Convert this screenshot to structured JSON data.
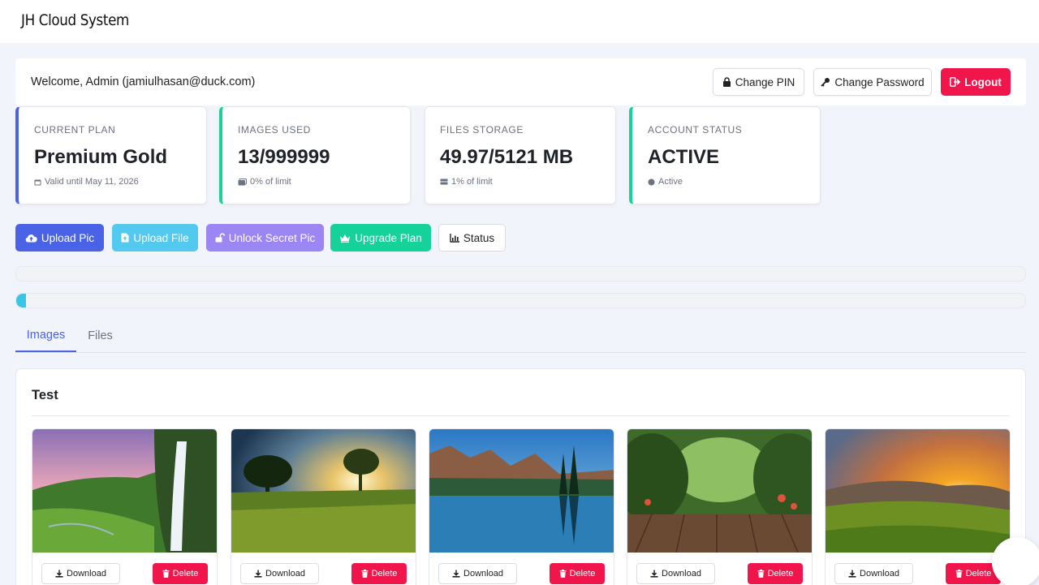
{
  "app": {
    "title": "JH Cloud System"
  },
  "header": {
    "welcome": "Welcome, Admin (jamiulhasan@duck.com)",
    "change_pin": "Change PIN",
    "change_password": "Change Password",
    "logout": "Logout"
  },
  "stats": [
    {
      "label": "CURRENT PLAN",
      "value": "Premium Gold",
      "sub": "Valid until May 11, 2026",
      "icon": "calendar-icon"
    },
    {
      "label": "IMAGES USED",
      "value": "13/999999",
      "sub": "0% of limit",
      "icon": "images-icon"
    },
    {
      "label": "FILES STORAGE",
      "value": "49.97/5121 MB",
      "sub": "1% of limit",
      "icon": "storage-icon"
    },
    {
      "label": "ACCOUNT STATUS",
      "value": "ACTIVE",
      "sub": "Active",
      "icon": "status-dot-icon"
    }
  ],
  "actions": {
    "upload_pic": "Upload Pic",
    "upload_file": "Upload File",
    "unlock_secret_pic": "Unlock Secret Pic",
    "upgrade_plan": "Upgrade Plan",
    "status": "Status"
  },
  "progress": {
    "bar1": 0,
    "bar2": 0.01
  },
  "tabs": [
    {
      "label": "Images",
      "active": true
    },
    {
      "label": "Files",
      "active": false
    }
  ],
  "album": {
    "title": "Test",
    "download_label": "Download",
    "delete_label": "Delete"
  },
  "colors": {
    "primary": "#4a63e6",
    "danger": "#f0154a",
    "info": "#53c9ef",
    "purple": "#9b86f4",
    "success": "#14d29a"
  }
}
